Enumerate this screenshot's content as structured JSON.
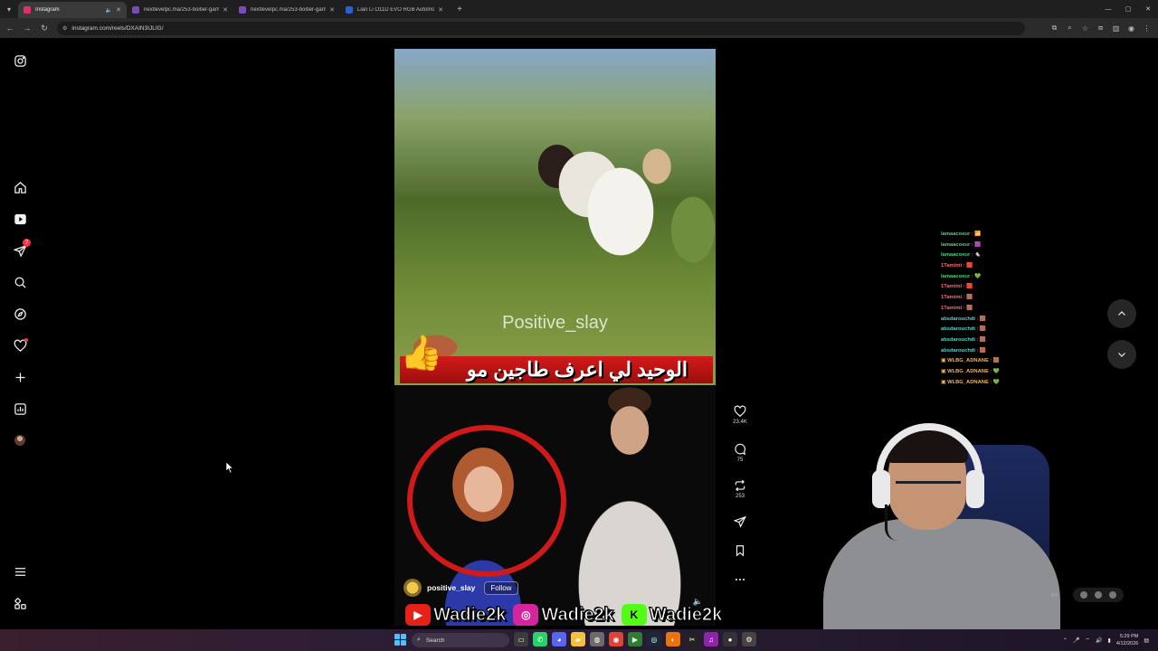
{
  "browser": {
    "tabs": [
      {
        "title": "Instagram",
        "active": true,
        "favicon_color": "#e1306c"
      },
      {
        "title": "nextlevelpc.ma/253-boitier-gam",
        "active": false,
        "favicon_color": "#7b4bb8"
      },
      {
        "title": "nextlevelpc.ma/253-boitier-gam",
        "active": false,
        "favicon_color": "#7b4bb8"
      },
      {
        "title": "Lian Li O11D EVO RGB Automo",
        "active": false,
        "favicon_color": "#2b5fd9"
      }
    ],
    "url": "instagram.com/reels/DXAIN3IJLIG/"
  },
  "sidebar": {
    "icons": [
      "instagram-logo-icon",
      "home-icon",
      "reels-icon",
      "messages-icon",
      "search-icon",
      "explore-icon",
      "notifications-icon",
      "create-icon",
      "dashboard-icon",
      "profile-avatar",
      "more-menu-icon",
      "meta-apps-icon"
    ],
    "messages_badge": "7"
  },
  "reel": {
    "watermark": "Positive_slay",
    "caption_overlay": "الوحيد لي اعرف طاجين مو",
    "username": "positive_slay",
    "follow_label": "Follow"
  },
  "actions": {
    "likes": "23.4K",
    "comments": "75",
    "reposts": "253"
  },
  "chat": {
    "lines": [
      {
        "user": "lamaacoeur",
        "color": "#4fd07a",
        "emote": "📶"
      },
      {
        "user": "lamaacoeur",
        "color": "#4fd07a",
        "emote": "🟪"
      },
      {
        "user": "lamaacoeur",
        "color": "#4fd07a",
        "emote": "🐁"
      },
      {
        "user": "1Tamimi",
        "color": "#ff6a6a",
        "emote": "🟥"
      },
      {
        "user": "lamaacoeur",
        "color": "#4fd07a",
        "emote": "💚"
      },
      {
        "user": "1Tamimi",
        "color": "#ff6a6a",
        "emote": "🟥"
      },
      {
        "user": "1Tamimi",
        "color": "#ff6a6a",
        "emote": "🟫"
      },
      {
        "user": "1Tamimi",
        "color": "#ff6a6a",
        "emote": "🟫"
      },
      {
        "user": "absdarouchdi",
        "color": "#5fd1c8",
        "emote": "🟫"
      },
      {
        "user": "absdarouchdi",
        "color": "#5fd1c8",
        "emote": "🟫"
      },
      {
        "user": "absdarouchdi",
        "color": "#5fd1c8",
        "emote": "🟫"
      },
      {
        "user": "absdarouchdi",
        "color": "#5fd1c8",
        "emote": "🟫"
      },
      {
        "user": "WLBG_ADNANE",
        "color": "#f3b15c",
        "emote": "🟫"
      },
      {
        "user": "WLBG_ADNANE",
        "color": "#f3b15c",
        "emote": "💚"
      },
      {
        "user": "WLBG_ADNANE",
        "color": "#f3b15c",
        "emote": "💚"
      }
    ]
  },
  "socials": [
    {
      "platform": "youtube-icon",
      "handle": "Wadie2k",
      "color": "#e62117"
    },
    {
      "platform": "instagram-icon",
      "handle": "Wadie2k",
      "color": "#d6249f"
    },
    {
      "platform": "kick-icon",
      "handle": "Wadie2k",
      "color": "#53fc18"
    }
  ],
  "webcam": {
    "side_label": "es"
  },
  "taskbar": {
    "search_label": "Search",
    "time": "5:29 PM",
    "date": "4/12/2026"
  }
}
